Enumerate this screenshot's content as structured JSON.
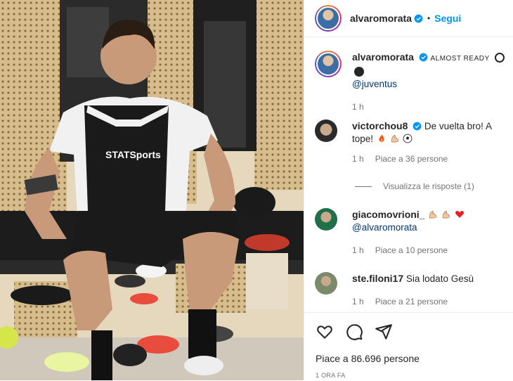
{
  "colors": {
    "verified": "#0095f6",
    "follow": "#0095f6",
    "mention": "#00376b",
    "muted": "#737373",
    "text": "#262626"
  },
  "header": {
    "username": "alvaromorata",
    "dot": "•",
    "follow": "Segui"
  },
  "caption": {
    "username": "alvaromorata",
    "text": "ALMOST READY",
    "mention": "@juventus",
    "time": "1 h"
  },
  "comments": [
    {
      "username": "victorchou8",
      "text": "De vuelta bro! A tope!",
      "icons": [
        "fire-icon",
        "flexed-biceps-icon",
        "soccer-ball-icon"
      ],
      "time": "1 h",
      "likes": "Piace a 36 persone"
    },
    {
      "username": "giacomovrioni_",
      "icons": [
        "flexed-biceps-icon",
        "flexed-biceps-icon",
        "red-heart-icon"
      ],
      "mention": "@alvaromorata",
      "time": "1 h",
      "likes": "Piace a 10 persone"
    },
    {
      "username": "ste.filoni17",
      "text": "Sia lodato Gesù",
      "time": "1 h",
      "likes": "Piace a 21 persone"
    }
  ],
  "replies": {
    "label": "Visualizza le risposte (1)"
  },
  "actions": {
    "icons": [
      "heart-icon",
      "comment-icon",
      "share-icon"
    ]
  },
  "likes": {
    "label": "Piace a 86.696 persone"
  },
  "timestamp": "1 ORA FA",
  "photo": {
    "jersey_text": "STATSports"
  }
}
